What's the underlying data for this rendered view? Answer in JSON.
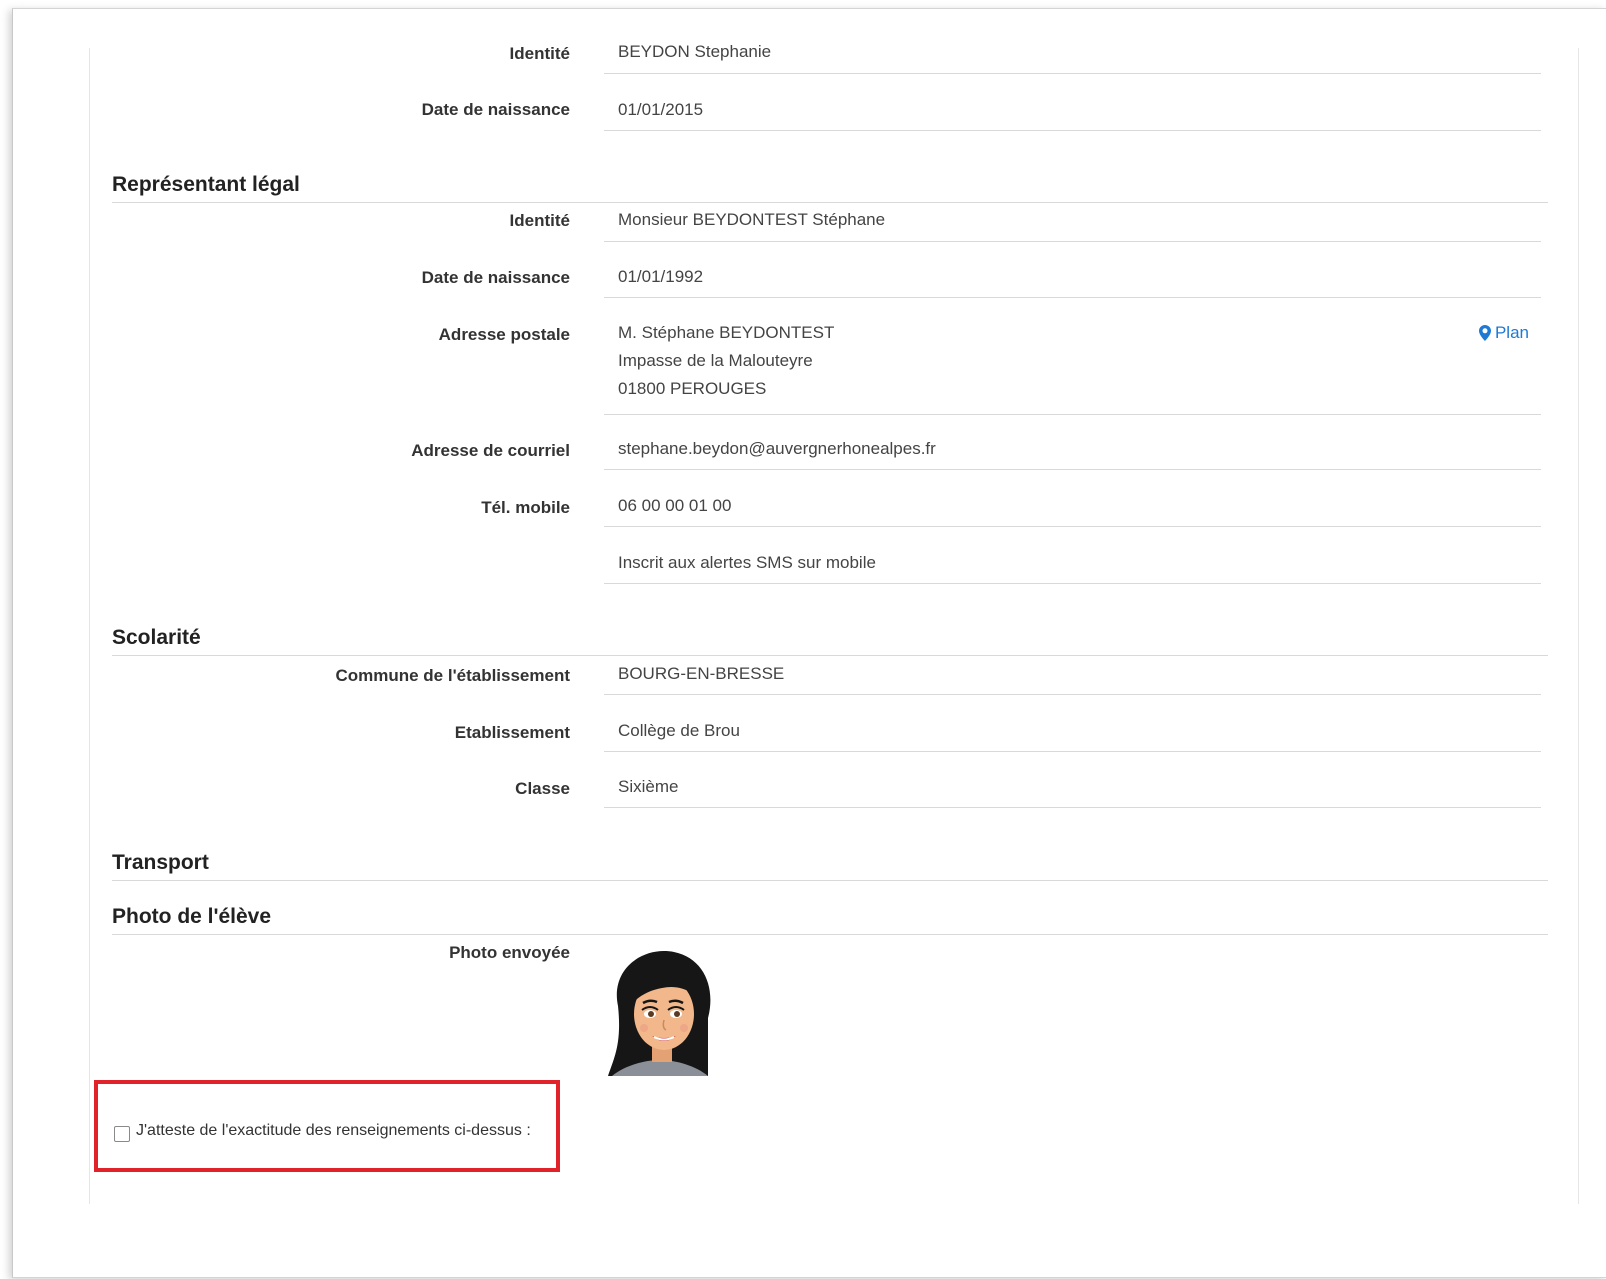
{
  "eleve": {
    "identite_label": "Identité",
    "identite_value": "BEYDON Stephanie",
    "naissance_label": "Date de naissance",
    "naissance_value": "01/01/2015"
  },
  "representant": {
    "title": "Représentant légal",
    "identite_label": "Identité",
    "identite_value": "Monsieur BEYDONTEST Stéphane",
    "naissance_label": "Date de naissance",
    "naissance_value": "01/01/1992",
    "adresse_label": "Adresse postale",
    "adresse_line1": "M. Stéphane BEYDONTEST",
    "adresse_line2": "Impasse de la Malouteyre",
    "adresse_line3": "01800 PEROUGES",
    "plan_label": "Plan",
    "courriel_label": "Adresse de courriel",
    "courriel_value": "stephane.beydon@auvergnerhonealpes.fr",
    "mobile_label": "Tél. mobile",
    "mobile_value": "06 00 00 01 00",
    "sms_value": "Inscrit aux alertes SMS sur mobile"
  },
  "scolarite": {
    "title": "Scolarité",
    "commune_label": "Commune de l'établissement",
    "commune_value": "BOURG-EN-BRESSE",
    "etablissement_label": "Etablissement",
    "etablissement_value": "Collège de Brou",
    "classe_label": "Classe",
    "classe_value": "Sixième"
  },
  "transport": {
    "title": "Transport"
  },
  "photo": {
    "title": "Photo de l'élève",
    "envoyee_label": "Photo envoyée"
  },
  "attestation": {
    "label": "J'atteste de l'exactitude des renseignements ci-dessus :",
    "checked": false
  },
  "colors": {
    "link": "#1e7ad2",
    "highlight": "#e2222b"
  },
  "icons": {
    "plan": "map-marker-icon",
    "photo": "student-avatar"
  }
}
